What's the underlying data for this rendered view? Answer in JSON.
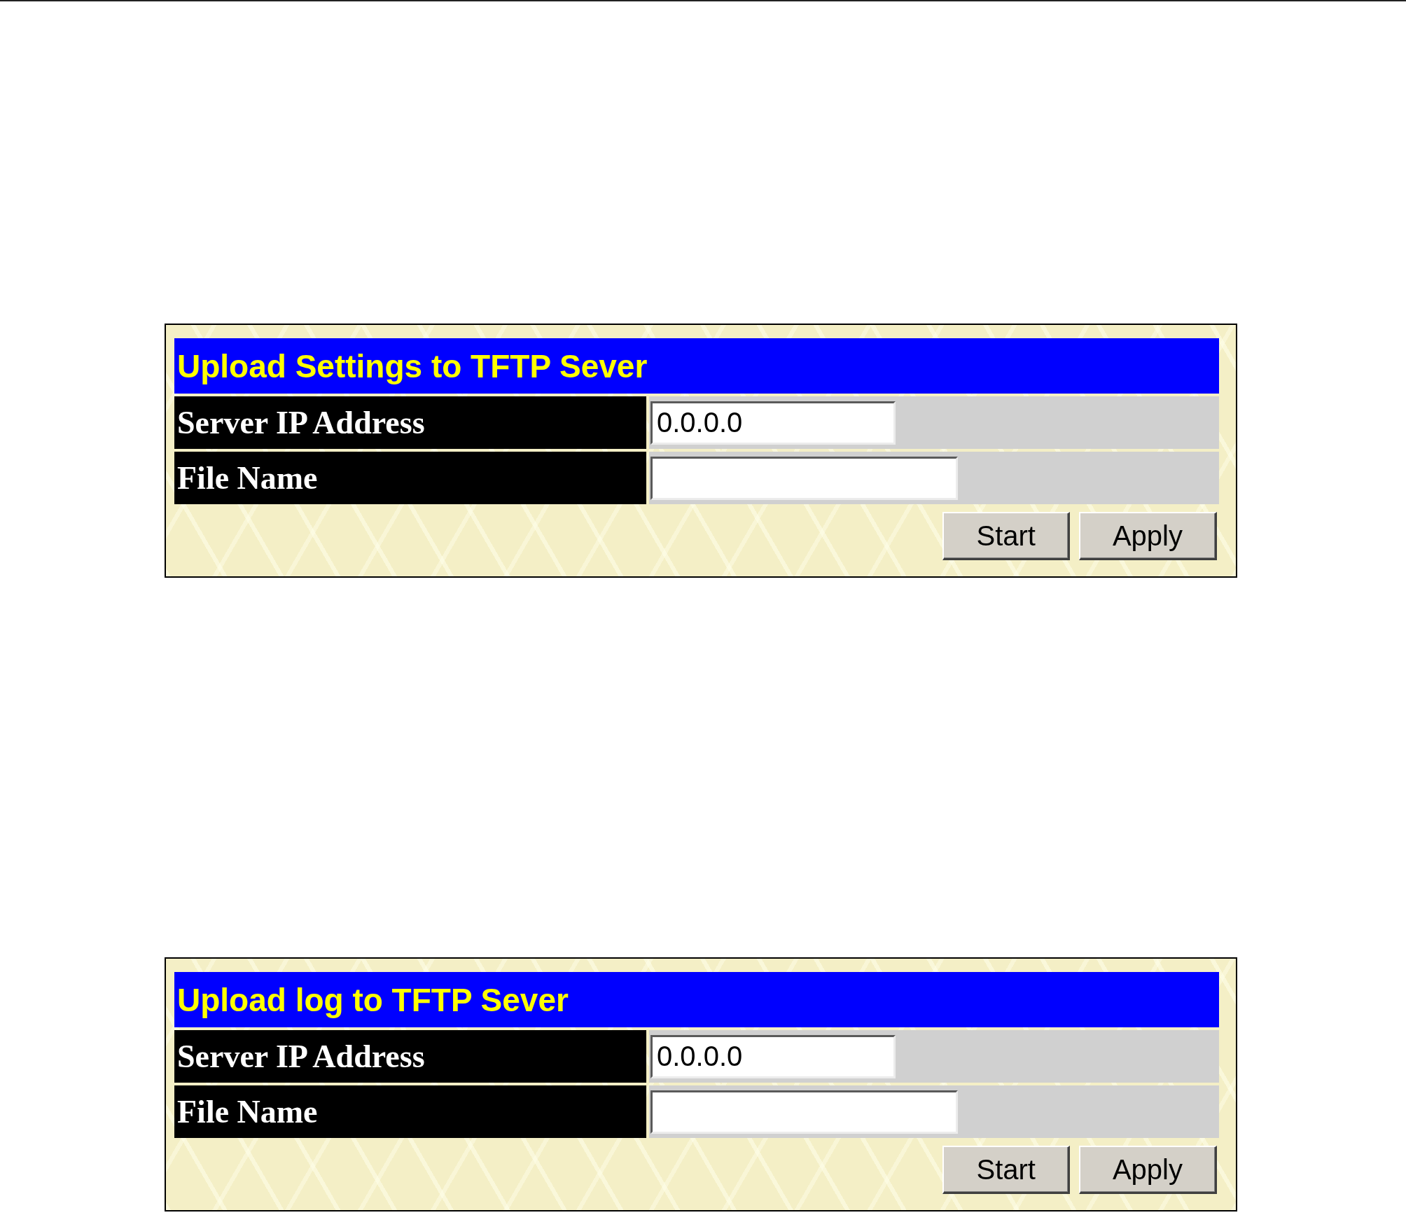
{
  "panels": [
    {
      "title": "Upload Settings to TFTP Sever",
      "fields": [
        {
          "label": "Server IP Address",
          "kind": "address",
          "value": "0.0.0.0"
        },
        {
          "label": "File Name",
          "kind": "file"
        }
      ],
      "buttons": [
        "Start",
        "Apply"
      ]
    },
    {
      "title": "Upload log to TFTP Sever",
      "fields": [
        {
          "label": "Server IP Address",
          "kind": "address",
          "value": "0.0.0.0"
        },
        {
          "label": "File Name",
          "kind": "file"
        }
      ],
      "buttons": [
        "Start",
        "Apply"
      ]
    }
  ]
}
